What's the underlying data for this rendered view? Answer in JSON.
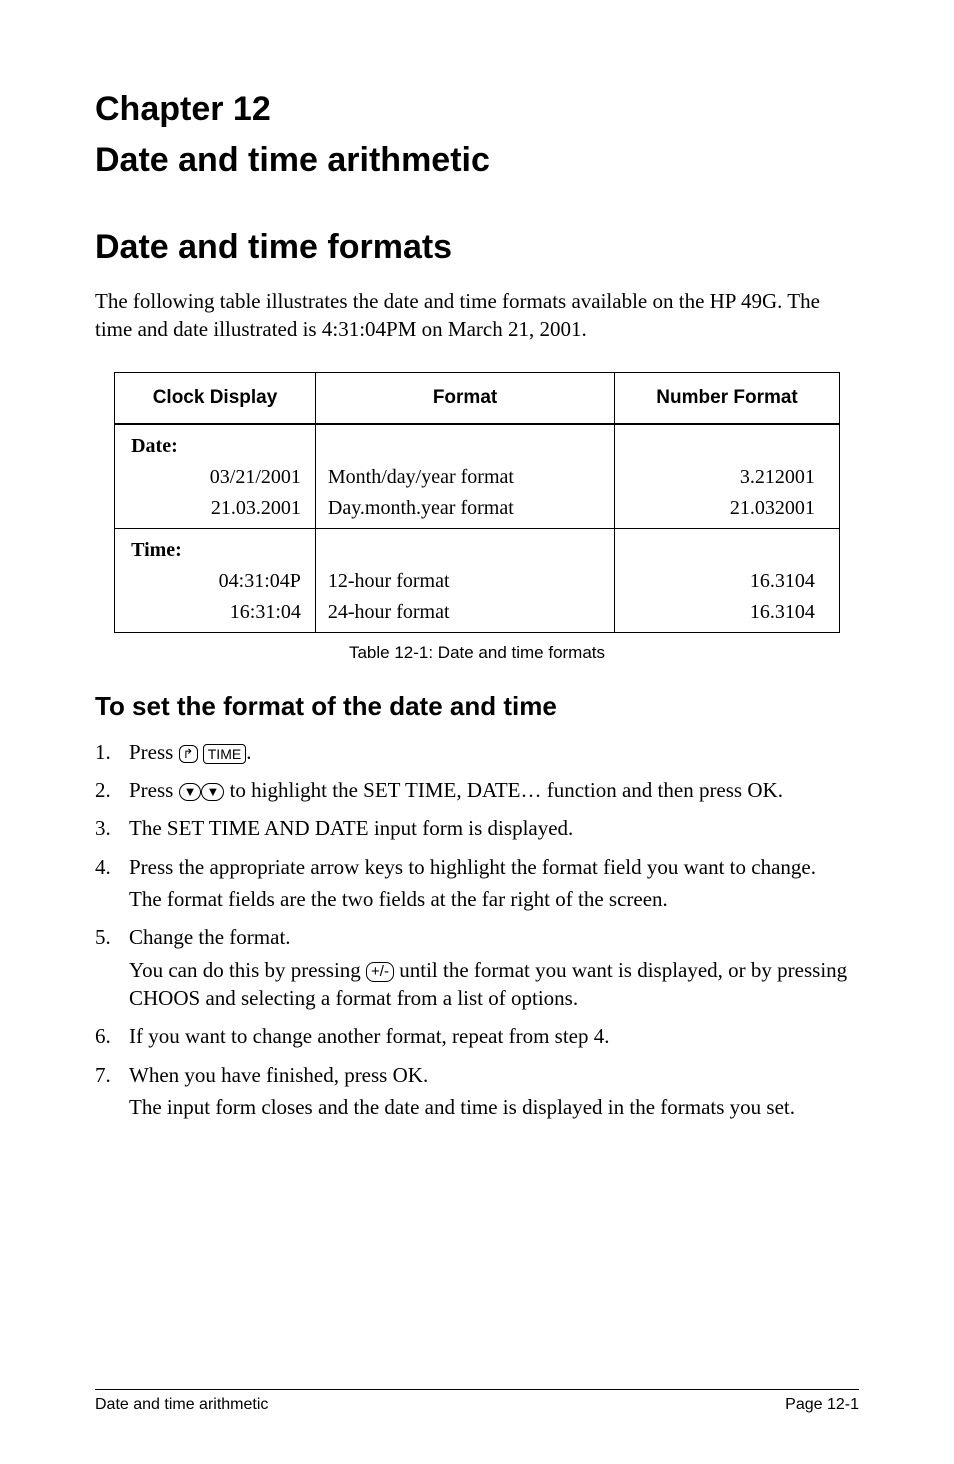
{
  "chapter": {
    "number": "Chapter 12",
    "title": "Date and time arithmetic"
  },
  "section": {
    "title": "Date and time formats",
    "intro_1": "The following table illustrates the date and time formats available on the HP 49G. The time and date illustrated is 4:31:04",
    "intro_pm": "PM",
    "intro_2": " on March 21, 2001."
  },
  "table": {
    "headers": {
      "col1": "Clock Display",
      "col2": "Format",
      "col3": "Number Format"
    },
    "date_label": "Date:",
    "date_rows": [
      {
        "display": "03/21/2001",
        "format": "Month/day/year format",
        "number": "3.212001"
      },
      {
        "display": "21.03.2001",
        "format": "Day.month.year format",
        "number": "21.032001"
      }
    ],
    "time_label": "Time:",
    "time_rows": [
      {
        "display": "04:31:04P",
        "format": "12-hour format",
        "number": "16.3104"
      },
      {
        "display": "16:31:04",
        "format": "24-hour format",
        "number": "16.3104"
      }
    ],
    "caption": "Table 12-1: Date and time formats"
  },
  "subsection": {
    "title": "To set the format of the date and time"
  },
  "steps": {
    "s1_a": "Press ",
    "s1_key1": "↱",
    "s1_key2": "TIME",
    "s1_b": ".",
    "s2_a": "Press ",
    "s2_arrow": "▼",
    "s2_b": " to highlight the ",
    "s2_fn": "SET TIME, DATE…",
    "s2_c": " function and then press ",
    "s2_ok": "OK",
    "s2_d": ".",
    "s3_a": "The ",
    "s3_fn": "SET TIME AND DATE",
    "s3_b": " input form is displayed.",
    "s4_a": "Press the appropriate arrow keys to highlight the format field you want to change.",
    "s4_b": "The format fields are the two fields at the far right of the screen.",
    "s5_a": "Change the format.",
    "s5_b1": "You can do this by pressing ",
    "s5_key": "+/-",
    "s5_b2": " until the format you want is displayed, or by pressing ",
    "s5_choos": "CHOOS",
    "s5_b3": " and selecting a format from a list of options.",
    "s6": "If you want to change another format, repeat from step 4.",
    "s7_a": "When you have finished, press ",
    "s7_ok": "OK",
    "s7_b": ".",
    "s7_c": "The input form closes and the date and time is displayed in the formats you set."
  },
  "footer": {
    "left": "Date and time arithmetic",
    "right": "Page 12-1"
  }
}
